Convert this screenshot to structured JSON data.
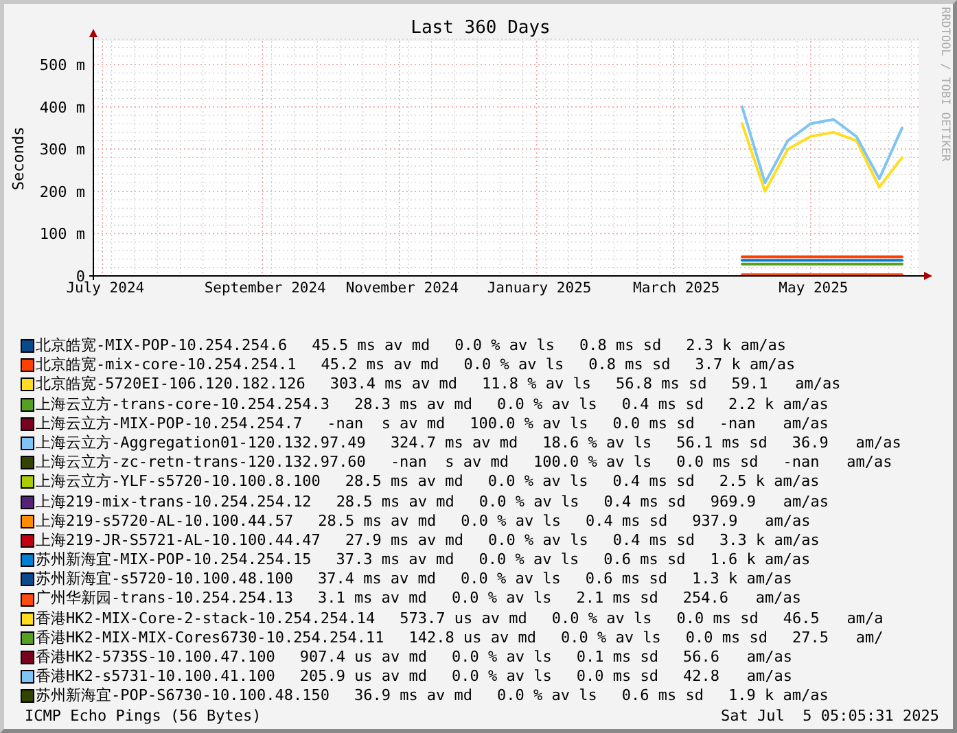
{
  "graph": {
    "credit": "RRDTOOL / TOBI OETIKER",
    "chart_data": {
      "type": "line",
      "title": "Last 360 Days",
      "ylabel": "Seconds",
      "grid": true,
      "ylim": [
        0,
        560
      ],
      "categories": [
        "July 2024",
        null,
        null,
        null,
        null,
        null,
        null,
        "September 2024",
        null,
        null,
        null,
        null,
        null,
        "November 2024",
        null,
        null,
        null,
        null,
        null,
        "January 2025",
        null,
        null,
        null,
        null,
        null,
        "March 2025",
        null,
        null,
        null,
        null,
        null,
        "May 2025",
        null,
        null,
        null,
        null
      ],
      "yticks": [
        {
          "value": 0,
          "label": "0"
        },
        {
          "value": 100,
          "label": "100 m"
        },
        {
          "value": 200,
          "label": "200 m"
        },
        {
          "value": 300,
          "label": "300 m"
        },
        {
          "value": 400,
          "label": "400 m"
        },
        {
          "value": 500,
          "label": "500 m"
        }
      ],
      "series": [
        {
          "color": "#ffdd22",
          "values": [
            null,
            null,
            null,
            null,
            null,
            null,
            null,
            null,
            null,
            null,
            null,
            null,
            null,
            null,
            null,
            null,
            null,
            null,
            null,
            null,
            null,
            null,
            null,
            null,
            null,
            null,
            null,
            null,
            360,
            200,
            300,
            330,
            340,
            320,
            210,
            280
          ]
        },
        {
          "color": "#7fc4f5",
          "values": [
            null,
            null,
            null,
            null,
            null,
            null,
            null,
            null,
            null,
            null,
            null,
            null,
            null,
            null,
            null,
            null,
            null,
            null,
            null,
            null,
            null,
            null,
            null,
            null,
            null,
            null,
            null,
            null,
            400,
            220,
            320,
            360,
            370,
            330,
            230,
            350
          ]
        },
        {
          "color": "#ff4000",
          "values": [
            null,
            null,
            null,
            null,
            null,
            null,
            null,
            null,
            null,
            null,
            null,
            null,
            null,
            null,
            null,
            null,
            null,
            null,
            null,
            null,
            null,
            null,
            null,
            null,
            null,
            null,
            null,
            null,
            45,
            45,
            45,
            45,
            45,
            45,
            45,
            45
          ]
        },
        {
          "color": "#0080d0",
          "values": [
            null,
            null,
            null,
            null,
            null,
            null,
            null,
            null,
            null,
            null,
            null,
            null,
            null,
            null,
            null,
            null,
            null,
            null,
            null,
            null,
            null,
            null,
            null,
            null,
            null,
            null,
            null,
            null,
            37,
            37,
            37,
            37,
            37,
            37,
            37,
            37
          ]
        },
        {
          "color": "#55a020",
          "values": [
            null,
            null,
            null,
            null,
            null,
            null,
            null,
            null,
            null,
            null,
            null,
            null,
            null,
            null,
            null,
            null,
            null,
            null,
            null,
            null,
            null,
            null,
            null,
            null,
            null,
            null,
            null,
            null,
            28,
            28,
            28,
            28,
            28,
            28,
            28,
            28
          ]
        },
        {
          "color": "#ff4a10",
          "values": [
            null,
            null,
            null,
            null,
            null,
            null,
            null,
            null,
            null,
            null,
            null,
            null,
            null,
            null,
            null,
            null,
            null,
            null,
            null,
            null,
            null,
            null,
            null,
            null,
            null,
            null,
            null,
            null,
            3,
            3,
            3,
            3,
            3,
            3,
            3,
            3
          ]
        }
      ]
    }
  },
  "legend": [
    {
      "name": "北京皓宽-MIX-POP-10.254.254.6",
      "color": "#0b4a8a",
      "median": "45.5 ms av md",
      "loss": "0.0 % av ls",
      "sd": "0.8 ms sd",
      "ratio": "2.3 k am/as"
    },
    {
      "name": "北京皓宽-mix-core-10.254.254.1",
      "color": "#ff4000",
      "median": "45.2 ms av md",
      "loss": "0.0 % av ls",
      "sd": "0.8 ms sd",
      "ratio": "3.7 k am/as"
    },
    {
      "name": "北京皓宽-5720EI-106.120.182.126",
      "color": "#ffdd22",
      "median": "303.4 ms av md",
      "loss": "11.8 % av ls",
      "sd": "56.8 ms sd",
      "ratio": "59.1   am/as"
    },
    {
      "name": "上海云立方-trans-core-10.254.254.3",
      "color": "#55a020",
      "median": "28.3 ms av md",
      "loss": "0.0 % av ls",
      "sd": "0.4 ms sd",
      "ratio": "2.2 k am/as"
    },
    {
      "name": "上海云立方-MIX-POP-10.254.254.7",
      "color": "#7a0020",
      "median": "-nan  s av md",
      "loss": "100.0 % av ls",
      "sd": "0.0 ms sd",
      "ratio": "-nan   am/as"
    },
    {
      "name": "上海云立方-Aggregation01-120.132.97.49",
      "color": "#7fc4f5",
      "median": "324.7 ms av md",
      "loss": "18.6 % av ls",
      "sd": "56.1 ms sd",
      "ratio": "36.9   am/as"
    },
    {
      "name": "上海云立方-zc-retn-trans-120.132.97.60",
      "color": "#334400",
      "median": "-nan  s av md",
      "loss": "100.0 % av ls",
      "sd": "0.0 ms sd",
      "ratio": "-nan   am/as"
    },
    {
      "name": "上海云立方-YLF-s5720-10.100.8.100",
      "color": "#aacc00",
      "median": "28.5 ms av md",
      "loss": "0.0 % av ls",
      "sd": "0.4 ms sd",
      "ratio": "2.5 k am/as"
    },
    {
      "name": "上海219-mix-trans-10.254.254.12",
      "color": "#552277",
      "median": "28.5 ms av md",
      "loss": "0.0 % av ls",
      "sd": "0.4 ms sd",
      "ratio": "969.9   am/as"
    },
    {
      "name": "上海219-s5720-AL-10.100.44.57",
      "color": "#ff8c00",
      "median": "28.5 ms av md",
      "loss": "0.0 % av ls",
      "sd": "0.4 ms sd",
      "ratio": "937.9   am/as"
    },
    {
      "name": "上海219-JR-S5721-AL-10.100.44.47",
      "color": "#c00010",
      "median": "27.9 ms av md",
      "loss": "0.0 % av ls",
      "sd": "0.4 ms sd",
      "ratio": "3.3 k am/as"
    },
    {
      "name": "苏州新海宜-MIX-POP-10.254.254.15",
      "color": "#0080d0",
      "median": "37.3 ms av md",
      "loss": "0.0 % av ls",
      "sd": "0.6 ms sd",
      "ratio": "1.6 k am/as"
    },
    {
      "name": "苏州新海宜-s5720-10.100.48.100",
      "color": "#0b4a8a",
      "median": "37.4 ms av md",
      "loss": "0.0 % av ls",
      "sd": "0.6 ms sd",
      "ratio": "1.3 k am/as"
    },
    {
      "name": "广州华新园-trans-10.254.254.13",
      "color": "#ff4a10",
      "median": "3.1 ms av md",
      "loss": "0.0 % av ls",
      "sd": "2.1 ms sd",
      "ratio": "254.6   am/as"
    },
    {
      "name": "香港HK2-MIX-Core-2-stack-10.254.254.14",
      "color": "#ffdd22",
      "median": "573.7 us av md",
      "loss": "0.0 % av ls",
      "sd": "0.0 ms sd",
      "ratio": "46.5   am/a"
    },
    {
      "name": "香港HK2-MIX-MIX-Cores6730-10.254.254.11",
      "color": "#55a020",
      "median": "142.8 us av md",
      "loss": "0.0 % av ls",
      "sd": "0.0 ms sd",
      "ratio": "27.5   am/"
    },
    {
      "name": "香港HK2-5735S-10.100.47.100",
      "color": "#7a0020",
      "median": "907.4 us av md",
      "loss": "0.0 % av ls",
      "sd": "0.1 ms sd",
      "ratio": "56.6   am/as"
    },
    {
      "name": "香港HK2-s5731-10.100.41.100",
      "color": "#7fc4f5",
      "median": "205.9 us av md",
      "loss": "0.0 % av ls",
      "sd": "0.0 ms sd",
      "ratio": "42.8   am/as"
    },
    {
      "name": "苏州新海宜-POP-S6730-10.100.48.150",
      "color": "#334400",
      "median": "36.9 ms av md",
      "loss": "0.0 % av ls",
      "sd": "0.6 ms sd",
      "ratio": "1.9 k am/as"
    }
  ],
  "footer": {
    "left": "ICMP Echo Pings (56 Bytes)",
    "right": "Sat Jul  5 05:05:31 2025"
  }
}
